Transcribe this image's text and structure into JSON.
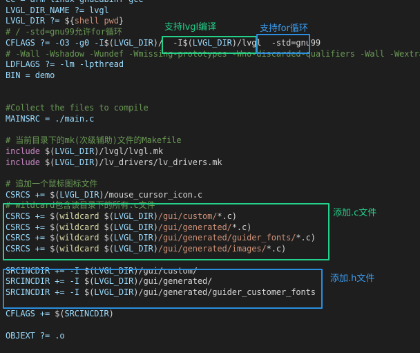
{
  "editor": {
    "lines": [
      {
        "segments": [
          {
            "t": "CC = arm-linux-gnueabihf-gcc",
            "c": "var"
          }
        ]
      },
      {
        "segments": [
          {
            "t": "LVGL_DIR_NAME ?= lvgl",
            "c": "var"
          }
        ]
      },
      {
        "segments": [
          {
            "t": "LVGL_DIR ?= ",
            "c": "var"
          },
          {
            "t": "${",
            "c": "op"
          },
          {
            "t": "shell pwd",
            "c": "str"
          },
          {
            "t": "}",
            "c": "op"
          }
        ]
      },
      {
        "segments": [
          {
            "t": "# / -std=gnu99允许for循环",
            "c": "cmt"
          }
        ]
      },
      {
        "segments": [
          {
            "t": "CFLAGS ?= -O3 -g0 -I",
            "c": "var"
          },
          {
            "t": "$(",
            "c": "op"
          },
          {
            "t": "LVGL_DIR",
            "c": "var"
          },
          {
            "t": ")/  -I",
            "c": "op"
          },
          {
            "t": "$(",
            "c": "op"
          },
          {
            "t": "LVGL_DIR",
            "c": "var"
          },
          {
            "t": ")/lvgl  -std=gnu99",
            "c": "op"
          }
        ]
      },
      {
        "segments": [
          {
            "t": "# -Wall -Wshadow -Wundef -Wmissing-prototypes -Wno-discarded-qualifiers -Wall -Wextra",
            "c": "cmt"
          }
        ]
      },
      {
        "segments": [
          {
            "t": "LDFLAGS ?= -lm -lpthread",
            "c": "var"
          }
        ]
      },
      {
        "segments": [
          {
            "t": "BIN = demo",
            "c": "var"
          }
        ]
      },
      {
        "segments": [
          {
            "t": "",
            "c": "op"
          }
        ]
      },
      {
        "segments": [
          {
            "t": "",
            "c": "op"
          }
        ]
      },
      {
        "segments": [
          {
            "t": "#Collect the files to compile",
            "c": "cmt"
          }
        ]
      },
      {
        "segments": [
          {
            "t": "MAINSRC = ./main.c",
            "c": "var"
          }
        ]
      },
      {
        "segments": [
          {
            "t": "",
            "c": "op"
          }
        ]
      },
      {
        "segments": [
          {
            "t": "# 当前目录下的mk(次级辅助)文件的Makefile",
            "c": "cmt"
          }
        ]
      },
      {
        "segments": [
          {
            "t": "include ",
            "c": "kw"
          },
          {
            "t": "$(",
            "c": "op"
          },
          {
            "t": "LVGL_DIR",
            "c": "var"
          },
          {
            "t": ")/lvgl/lvgl.mk",
            "c": "op"
          }
        ]
      },
      {
        "segments": [
          {
            "t": "include ",
            "c": "kw"
          },
          {
            "t": "$(",
            "c": "op"
          },
          {
            "t": "LVGL_DIR",
            "c": "var"
          },
          {
            "t": ")/lv_drivers/lv_drivers.mk",
            "c": "op"
          }
        ]
      },
      {
        "segments": [
          {
            "t": "",
            "c": "op"
          }
        ]
      },
      {
        "segments": [
          {
            "t": "# 追加一个鼠标图标文件",
            "c": "cmt"
          }
        ]
      },
      {
        "segments": [
          {
            "t": "CSRCS += ",
            "c": "var"
          },
          {
            "t": "$(",
            "c": "op"
          },
          {
            "t": "LVGL_DIR",
            "c": "var"
          },
          {
            "t": ")/mouse_cursor_icon.c",
            "c": "op"
          }
        ]
      },
      {
        "segments": [
          {
            "t": "# wildcard包含该目录下的所有.c文件",
            "c": "cmt"
          }
        ]
      },
      {
        "segments": [
          {
            "t": "CSRCS += ",
            "c": "var"
          },
          {
            "t": "$(",
            "c": "op"
          },
          {
            "t": "wildcard ",
            "c": "fn"
          },
          {
            "t": "$(",
            "c": "op"
          },
          {
            "t": "LVGL_DIR",
            "c": "var"
          },
          {
            "t": ")",
            "c": "op"
          },
          {
            "t": "/gui/custom/",
            "c": "str"
          },
          {
            "t": "*.c)",
            "c": "op"
          }
        ]
      },
      {
        "segments": [
          {
            "t": "CSRCS += ",
            "c": "var"
          },
          {
            "t": "$(",
            "c": "op"
          },
          {
            "t": "wildcard ",
            "c": "fn"
          },
          {
            "t": "$(",
            "c": "op"
          },
          {
            "t": "LVGL_DIR",
            "c": "var"
          },
          {
            "t": ")",
            "c": "op"
          },
          {
            "t": "/gui/generated/",
            "c": "str"
          },
          {
            "t": "*.c)",
            "c": "op"
          }
        ]
      },
      {
        "segments": [
          {
            "t": "CSRCS += ",
            "c": "var"
          },
          {
            "t": "$(",
            "c": "op"
          },
          {
            "t": "wildcard ",
            "c": "fn"
          },
          {
            "t": "$(",
            "c": "op"
          },
          {
            "t": "LVGL_DIR",
            "c": "var"
          },
          {
            "t": ")",
            "c": "op"
          },
          {
            "t": "/gui/generated/guider_fonts/",
            "c": "str"
          },
          {
            "t": "*.c)",
            "c": "op"
          }
        ]
      },
      {
        "segments": [
          {
            "t": "CSRCS += ",
            "c": "var"
          },
          {
            "t": "$(",
            "c": "op"
          },
          {
            "t": "wildcard ",
            "c": "fn"
          },
          {
            "t": "$(",
            "c": "op"
          },
          {
            "t": "LVGL_DIR",
            "c": "var"
          },
          {
            "t": ")",
            "c": "op"
          },
          {
            "t": "/gui/generated/images/",
            "c": "str"
          },
          {
            "t": "*.c)",
            "c": "op"
          }
        ]
      },
      {
        "segments": [
          {
            "t": "",
            "c": "op"
          }
        ]
      },
      {
        "segments": [
          {
            "t": "SRCINCDIR += -I ",
            "c": "var"
          },
          {
            "t": "$(",
            "c": "op"
          },
          {
            "t": "LVGL_DIR",
            "c": "var"
          },
          {
            "t": ")/gui/custom/",
            "c": "op"
          }
        ]
      },
      {
        "segments": [
          {
            "t": "SRCINCDIR += -I ",
            "c": "var"
          },
          {
            "t": "$(",
            "c": "op"
          },
          {
            "t": "LVGL_DIR",
            "c": "var"
          },
          {
            "t": ")/gui/generated/",
            "c": "op"
          }
        ]
      },
      {
        "segments": [
          {
            "t": "SRCINCDIR += -I ",
            "c": "var"
          },
          {
            "t": "$(",
            "c": "op"
          },
          {
            "t": "LVGL_DIR",
            "c": "var"
          },
          {
            "t": ")/gui/generated/guider_customer_fonts",
            "c": "op"
          }
        ]
      },
      {
        "segments": [
          {
            "t": "",
            "c": "op"
          }
        ]
      },
      {
        "segments": [
          {
            "t": "CFLAGS += ",
            "c": "var"
          },
          {
            "t": "$(",
            "c": "op"
          },
          {
            "t": "SRCINCDIR",
            "c": "var"
          },
          {
            "t": ")",
            "c": "op"
          }
        ]
      },
      {
        "segments": [
          {
            "t": "",
            "c": "op"
          }
        ]
      },
      {
        "segments": [
          {
            "t": "OBJEXT ?= .o",
            "c": "var"
          }
        ]
      }
    ]
  },
  "annotations": {
    "lvgl_label": "支持lvgl编译",
    "for_label": "支持for循环",
    "c_label": "添加.c文件",
    "h_label": "添加.h文件"
  },
  "colors": {
    "background": "#1e1e1e",
    "comment": "#6a9955",
    "variable": "#9cdcfe",
    "string": "#ce9178",
    "keyword": "#c586c0",
    "function": "#dcdcaa",
    "green_box": "#23d18b",
    "blue_box": "#2a8fe0"
  }
}
